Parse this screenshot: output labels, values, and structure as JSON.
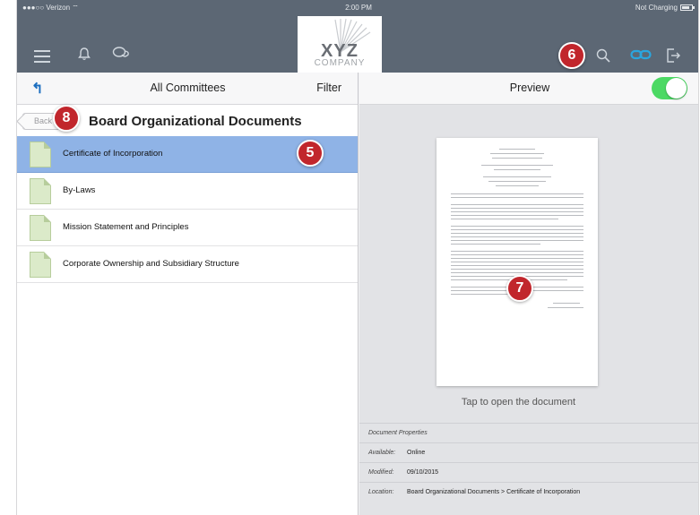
{
  "status_bar": {
    "carrier": "●●●○○ Verizon ⌔",
    "time": "2:00 PM",
    "battery_text": "Not Charging"
  },
  "nav": {
    "logo_text": "XYZ",
    "logo_subtext": "COMPANY"
  },
  "badges": {
    "b5": "5",
    "b6": "6",
    "b7": "7",
    "b8": "8"
  },
  "left_pane": {
    "header_title": "All Committees",
    "filter_label": "Filter",
    "back_label": "Back",
    "folder_title": "Board Organizational Documents",
    "documents": [
      {
        "label": "Certificate of Incorporation",
        "selected": true
      },
      {
        "label": "By-Laws",
        "selected": false
      },
      {
        "label": "Mission Statement and Principles",
        "selected": false
      },
      {
        "label": "Corporate Ownership and Subsidiary Structure",
        "selected": false
      }
    ]
  },
  "right_pane": {
    "header_title": "Preview",
    "preview_toggle_on": true,
    "tap_hint": "Tap to open the document",
    "properties": {
      "heading": "Document Properties",
      "available_label": "Available:",
      "available_value": "Online",
      "modified_label": "Modified:",
      "modified_value": "09/10/2015",
      "location_label": "Location:",
      "location_value": "Board Organizational Documents > Certificate of Incorporation"
    }
  },
  "colors": {
    "navbar": "#5c6774",
    "selection": "#8fb3e6",
    "badge": "#c1262c",
    "toggle": "#4cd964",
    "link_icon": "#2aa6df"
  }
}
